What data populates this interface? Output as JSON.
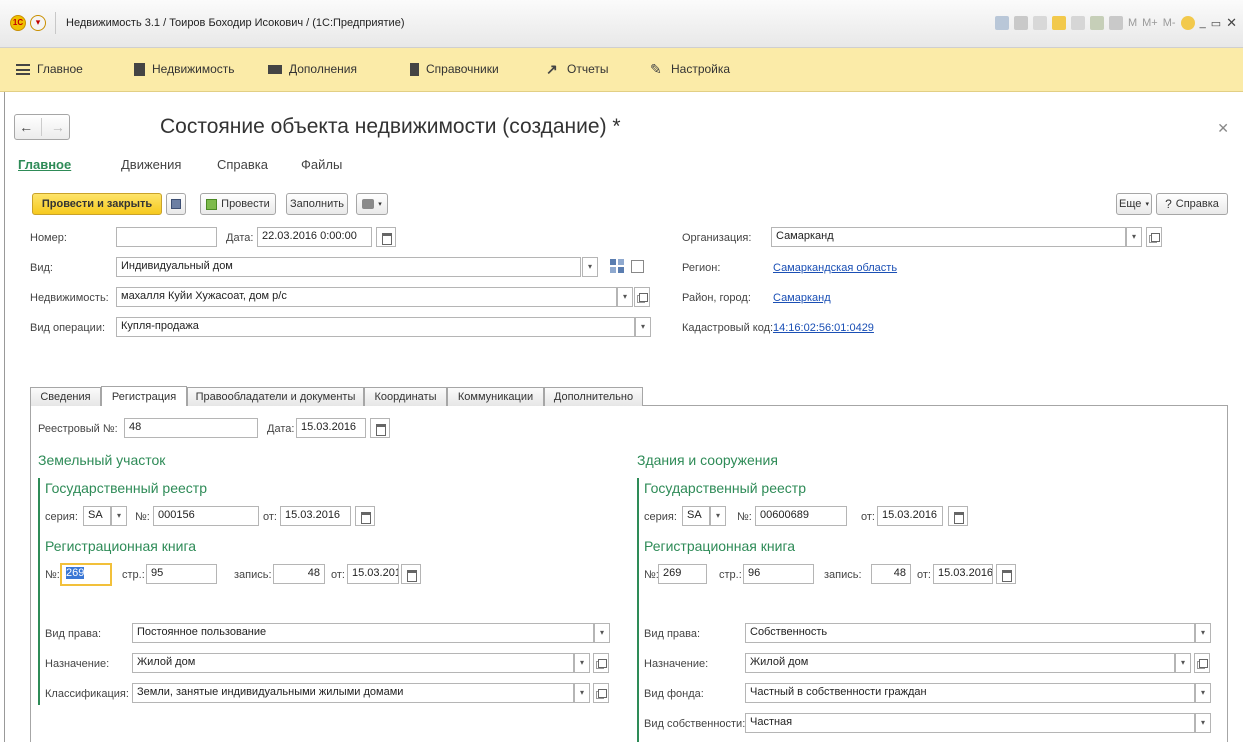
{
  "window": {
    "title": "Недвижимость 3.1 / Тоиров Боходир Исокович /  (1С:Предприятие)",
    "logo_text": "1С",
    "tools": [
      "M",
      "M+",
      "M-"
    ]
  },
  "sections": [
    {
      "label": "Главное",
      "icon": "menu-icon"
    },
    {
      "label": "Недвижимость",
      "icon": "property-icon"
    },
    {
      "label": "Дополнения",
      "icon": "additions-icon"
    },
    {
      "label": "Справочники",
      "icon": "book-icon"
    },
    {
      "label": "Отчеты",
      "icon": "chart-icon"
    },
    {
      "label": "Настройка",
      "icon": "wrench-icon"
    }
  ],
  "form": {
    "title": "Состояние объекта недвижимости (создание) *",
    "tabs": [
      "Главное",
      "Движения",
      "Справка",
      "Файлы"
    ],
    "active_tab": "Главное"
  },
  "toolbar": {
    "post_close": "Провести и закрыть",
    "post": "Провести",
    "fill": "Заполнить",
    "more": "Еще",
    "help": "Справка"
  },
  "header_fields": {
    "number_label": "Номер:",
    "number_value": "",
    "date_label": "Дата:",
    "date_value": "22.03.2016  0:00:00",
    "kind_label": "Вид:",
    "kind_value": "Индивидуальный дом",
    "property_label": "Недвижимость:",
    "property_value": "махалля Куйи Хужасоат, дом р/с",
    "operation_label": "Вид операции:",
    "operation_value": "Купля-продажа",
    "org_label": "Организация:",
    "org_value": "Самарканд",
    "region_label": "Регион:",
    "region_value": "Самаркандская область",
    "district_label": "Район, город:",
    "district_value": "Самарканд",
    "cadastre_label": "Кадастровый код:",
    "cadastre_value": "14:16:02:56:01:0429   "
  },
  "tabs": [
    "Сведения",
    "Регистрация",
    "Правообладатели и документы",
    "Координаты",
    "Коммуникации",
    "Дополнительно"
  ],
  "active_inner_tab": "Регистрация",
  "registration": {
    "registry_no_label": "Реестровый №:",
    "registry_no": "48",
    "date_label": "Дата:",
    "date": "15.03.2016"
  },
  "land": {
    "title": "Земельный участок",
    "state_registry": "Государственный реестр",
    "series_label": "серия:",
    "series": "SA",
    "no_label": "№:",
    "no": "000156",
    "from_label": "от:",
    "from": "15.03.2016",
    "reg_book": "Регистрационная книга",
    "book_no_label": "№:",
    "book_no": "269",
    "page_label": "стр.:",
    "page": "95",
    "record_label": "запись:",
    "record": "48",
    "book_from_label": "от:",
    "book_from": "15.03.2016",
    "right_label": "Вид права:",
    "right": "Постоянное пользование",
    "purpose_label": "Назначение:",
    "purpose": "Жилой дом",
    "class_label": "Классификация:",
    "class": "Земли, занятые индивидуальными жилыми домами"
  },
  "building": {
    "title": "Здания и сооружения",
    "state_registry": "Государственный реестр",
    "series_label": "серия:",
    "series": "SA",
    "no_label": "№:",
    "no": "00600689",
    "from_label": "от:",
    "from": "15.03.2016",
    "reg_book": "Регистрационная книга",
    "book_no_label": "№:",
    "book_no": "269",
    "page_label": "стр.:",
    "page": "96",
    "record_label": "запись:",
    "record": "48",
    "book_from_label": "от:",
    "book_from": "15.03.2016",
    "right_label": "Вид права:",
    "right": "Собственность",
    "purpose_label": "Назначение:",
    "purpose": "Жилой дом",
    "fund_label": "Вид фонда:",
    "fund": "Частный в собственности граждан",
    "ownership_label": "Вид собственности:",
    "ownership": "Частная"
  },
  "colors": {
    "accent_green": "#2e8b57",
    "section_bar": "#fbeba8",
    "primary_button": "#f6c91e",
    "link": "#1a4fb5"
  }
}
